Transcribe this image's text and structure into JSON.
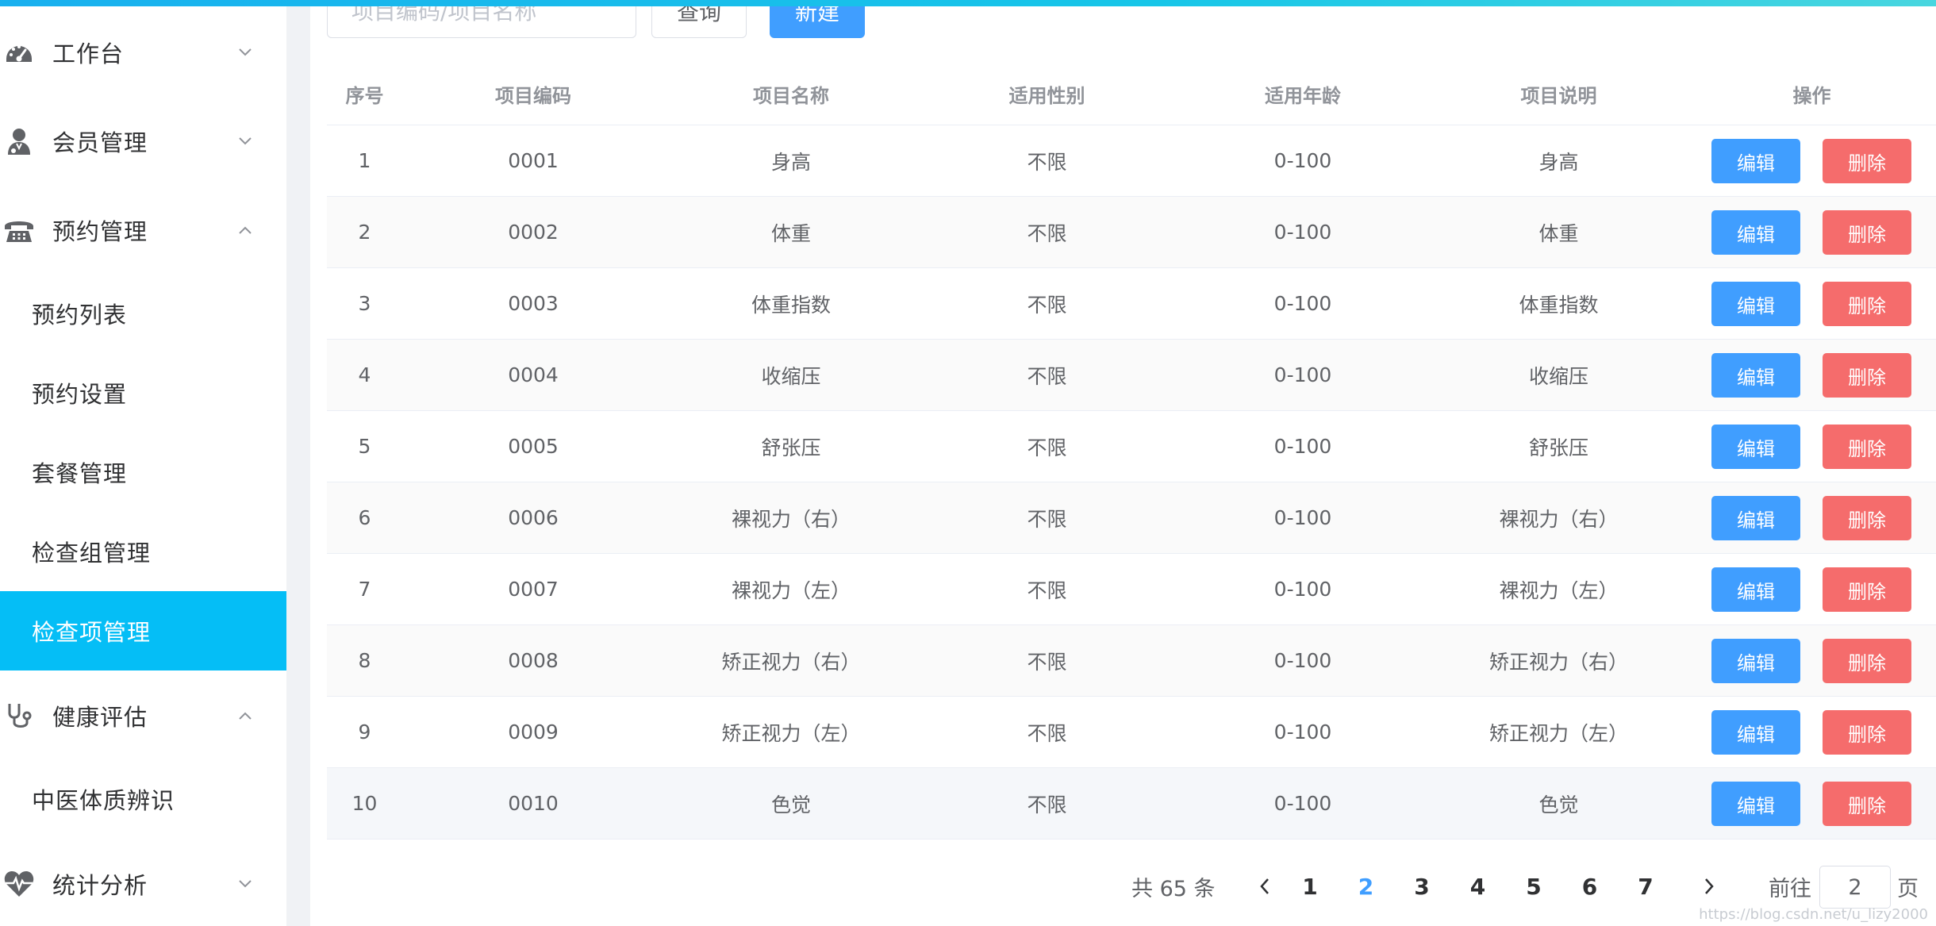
{
  "sidebar": {
    "groups": {
      "workbench": "工作台",
      "members": "会员管理",
      "appointments": "预约管理",
      "health": "健康评估",
      "stats": "统计分析"
    },
    "sub_items": {
      "appointment_list": "预约列表",
      "appointment_settings": "预约设置",
      "package_management": "套餐管理",
      "check_group_management": "检查组管理",
      "check_item_management": "检查项管理",
      "tcm_constitution": "中医体质辨识"
    },
    "active_item": "检查项管理"
  },
  "toolbar": {
    "search_placeholder": "项目编码/项目名称",
    "query_label": "查询",
    "new_label": "新建"
  },
  "table": {
    "headers": {
      "index": "序号",
      "code": "项目编码",
      "name": "项目名称",
      "gender": "适用性别",
      "age": "适用年龄",
      "remark": "项目说明",
      "actions": "操作"
    },
    "edit_label": "编辑",
    "delete_label": "删除",
    "rows": [
      {
        "index": "1",
        "code": "0001",
        "name": "身高",
        "gender": "不限",
        "age": "0-100",
        "remark": "身高"
      },
      {
        "index": "2",
        "code": "0002",
        "name": "体重",
        "gender": "不限",
        "age": "0-100",
        "remark": "体重"
      },
      {
        "index": "3",
        "code": "0003",
        "name": "体重指数",
        "gender": "不限",
        "age": "0-100",
        "remark": "体重指数"
      },
      {
        "index": "4",
        "code": "0004",
        "name": "收缩压",
        "gender": "不限",
        "age": "0-100",
        "remark": "收缩压"
      },
      {
        "index": "5",
        "code": "0005",
        "name": "舒张压",
        "gender": "不限",
        "age": "0-100",
        "remark": "舒张压"
      },
      {
        "index": "6",
        "code": "0006",
        "name": "裸视力（右）",
        "gender": "不限",
        "age": "0-100",
        "remark": "裸视力（右）"
      },
      {
        "index": "7",
        "code": "0007",
        "name": "裸视力（左）",
        "gender": "不限",
        "age": "0-100",
        "remark": "裸视力（左）"
      },
      {
        "index": "8",
        "code": "0008",
        "name": "矫正视力（右）",
        "gender": "不限",
        "age": "0-100",
        "remark": "矫正视力（右）"
      },
      {
        "index": "9",
        "code": "0009",
        "name": "矫正视力（左）",
        "gender": "不限",
        "age": "0-100",
        "remark": "矫正视力（左）"
      },
      {
        "index": "10",
        "code": "0010",
        "name": "色觉",
        "gender": "不限",
        "age": "0-100",
        "remark": "色觉"
      }
    ]
  },
  "pagination": {
    "total_text": "共 65 条",
    "pages": [
      "1",
      "2",
      "3",
      "4",
      "5",
      "6",
      "7"
    ],
    "current_page": "2",
    "goto_label": "前往",
    "goto_value": "2",
    "page_unit": "页"
  },
  "watermark": "https://blog.csdn.net/u_lizy2000",
  "colors": {
    "sidebar_active": "#05bef6",
    "primary": "#409eff",
    "danger": "#f56c6c"
  },
  "icons": {
    "workbench": "dashboard-icon",
    "members": "user-icon",
    "appointments": "telephone-icon",
    "health": "stethoscope-icon",
    "stats": "heartbeat-icon"
  }
}
